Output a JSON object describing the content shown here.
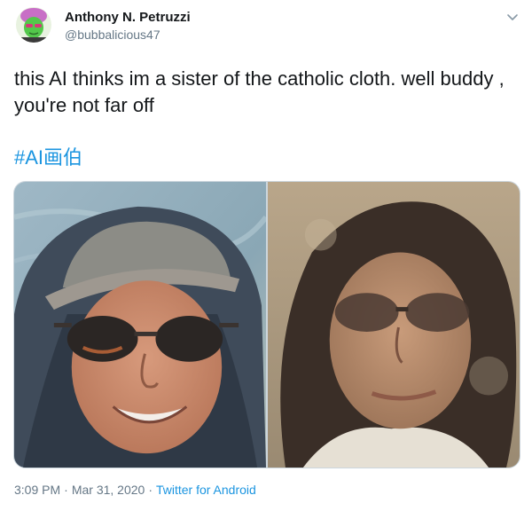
{
  "author": {
    "name": "Anthony N. Petruzzi",
    "handle": "@bubbalicious47"
  },
  "tweet": {
    "text": "this AI thinks im a sister of the catholic cloth. well buddy , you're not far off",
    "hashtag": "#AI画伯"
  },
  "media": {
    "photos": [
      {
        "icon": "selfie-photo",
        "subject": "man in grey hoodie, cap and sunglasses"
      },
      {
        "icon": "ai-painting-photo",
        "subject": "painted nun-like portrait with sunglasses"
      }
    ]
  },
  "footer": {
    "time": "3:09 PM",
    "date": "Mar 31, 2020",
    "separator": "·",
    "source": "Twitter for Android"
  },
  "colors": {
    "text": "#14171a",
    "secondary": "#657786",
    "link": "#1b95e0",
    "border": "#ccd6dd"
  },
  "icons": {
    "avatar": "avatar-icon",
    "menu": "chevron-down-icon"
  }
}
